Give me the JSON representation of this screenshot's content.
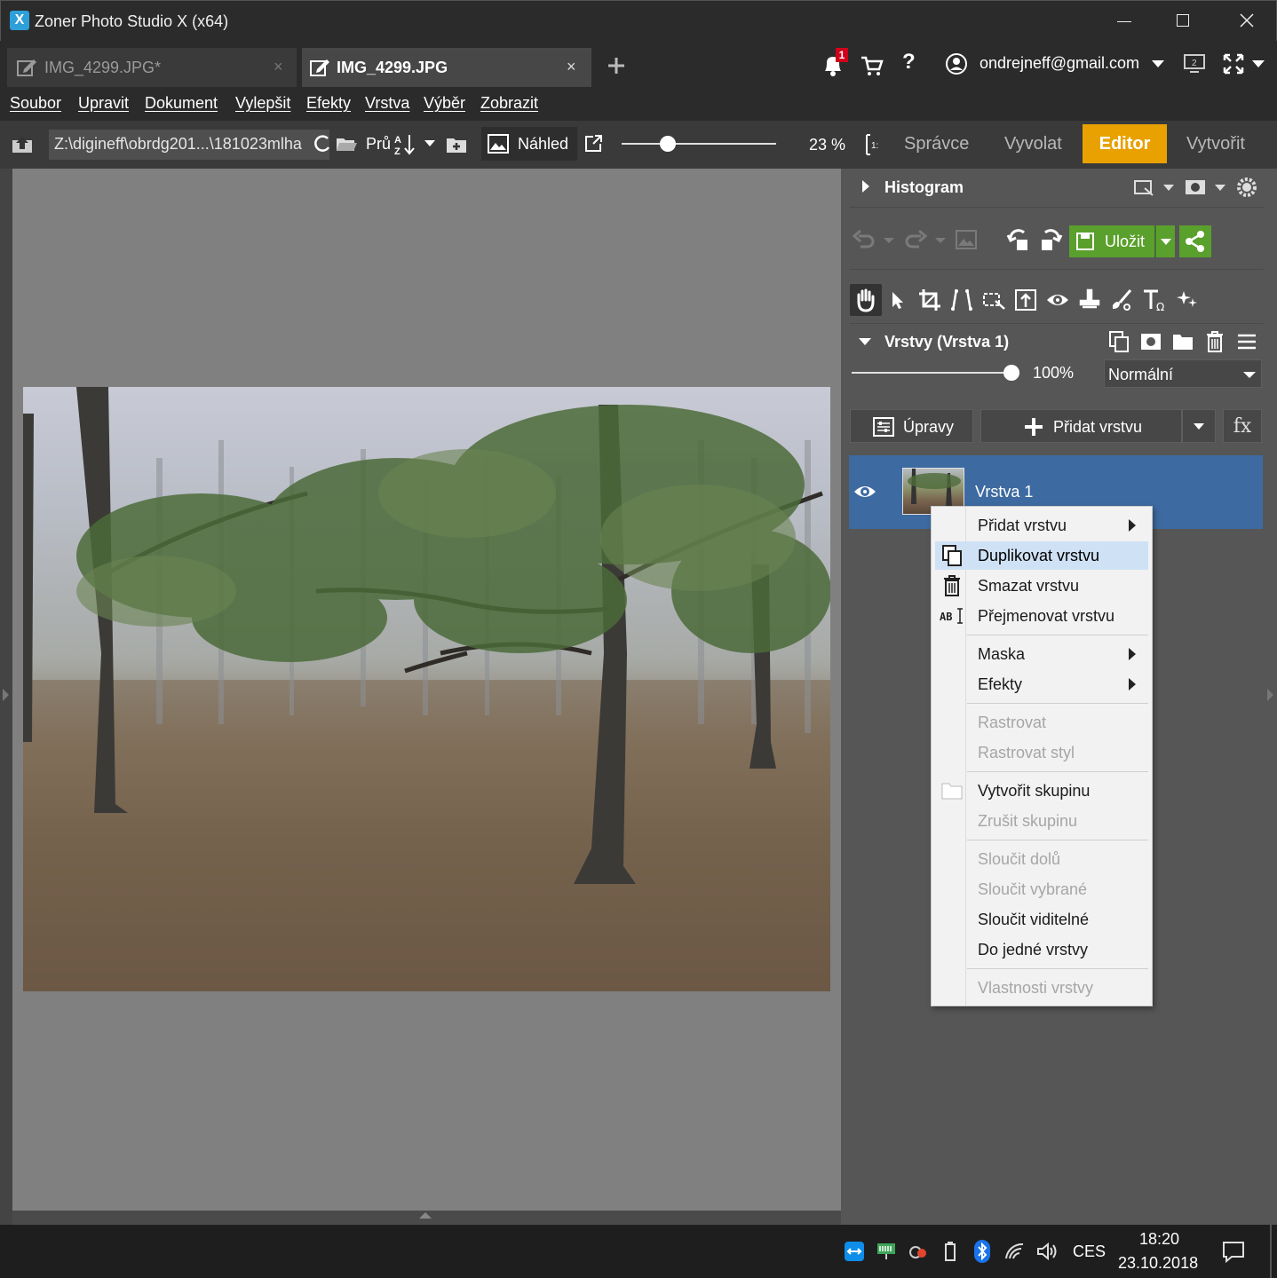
{
  "app": {
    "title": "Zoner Photo Studio X (x64)"
  },
  "tabs": [
    {
      "label": "IMG_4299.JPG*"
    },
    {
      "label": "IMG_4299.JPG"
    }
  ],
  "header": {
    "notification_count": "1",
    "account": "ondrejneff@gmail.com"
  },
  "menu": [
    "Soubor",
    "Upravit",
    "Dokument",
    "Vylepšit",
    "Efekty",
    "Vrstva",
    "Výběr",
    "Zobrazit"
  ],
  "toolbar": {
    "path": "Z:\\digineff\\obrdg201...\\181023mlha",
    "sort_label": "Prů",
    "preview_label": "Náhled",
    "zoom": "23 %",
    "zoom_level": 0.3,
    "modules": [
      "Správce",
      "Vyvolat",
      "Editor",
      "Vytvořit"
    ],
    "active_module": "Editor",
    "active_color": "#e8a100"
  },
  "panel": {
    "histogram_title": "Histogram",
    "save_label": "Uložit",
    "save_color": "#5aa02c",
    "layers_title": "Vrstvy (Vrstva 1)",
    "opacity": "100%",
    "opacity_level": 1.0,
    "blend_mode": "Normální",
    "adjustments_label": "Úpravy",
    "add_layer_label": "Přidat vrstvu",
    "fx_label": "fx",
    "layer_name": "Vrstva 1",
    "layer_selected_color": "#3d6aa0"
  },
  "context_menu": {
    "items": [
      {
        "label": "Přidat vrstvu",
        "submenu": true,
        "enabled": true
      },
      {
        "label": "Duplikovat vrstvu",
        "enabled": true,
        "highlighted": true
      },
      {
        "label": "Smazat vrstvu",
        "enabled": true
      },
      {
        "label": "Přejmenovat vrstvu",
        "enabled": true
      },
      {
        "label": "Maska",
        "submenu": true,
        "enabled": true
      },
      {
        "label": "Efekty",
        "submenu": true,
        "enabled": true
      },
      {
        "label": "Rastrovat",
        "enabled": false
      },
      {
        "label": "Rastrovat styl",
        "enabled": false
      },
      {
        "label": "Vytvořit skupinu",
        "enabled": true
      },
      {
        "label": "Zrušit skupinu",
        "enabled": false
      },
      {
        "label": "Sloučit dolů",
        "enabled": false
      },
      {
        "label": "Sloučit vybrané",
        "enabled": false
      },
      {
        "label": "Sloučit viditelné",
        "enabled": true
      },
      {
        "label": "Do jedné vrstvy",
        "enabled": true
      },
      {
        "label": "Vlastnosti vrstvy",
        "enabled": false
      }
    ]
  },
  "taskbar": {
    "language": "CES",
    "time": "18:20",
    "date": "23.10.2018"
  }
}
